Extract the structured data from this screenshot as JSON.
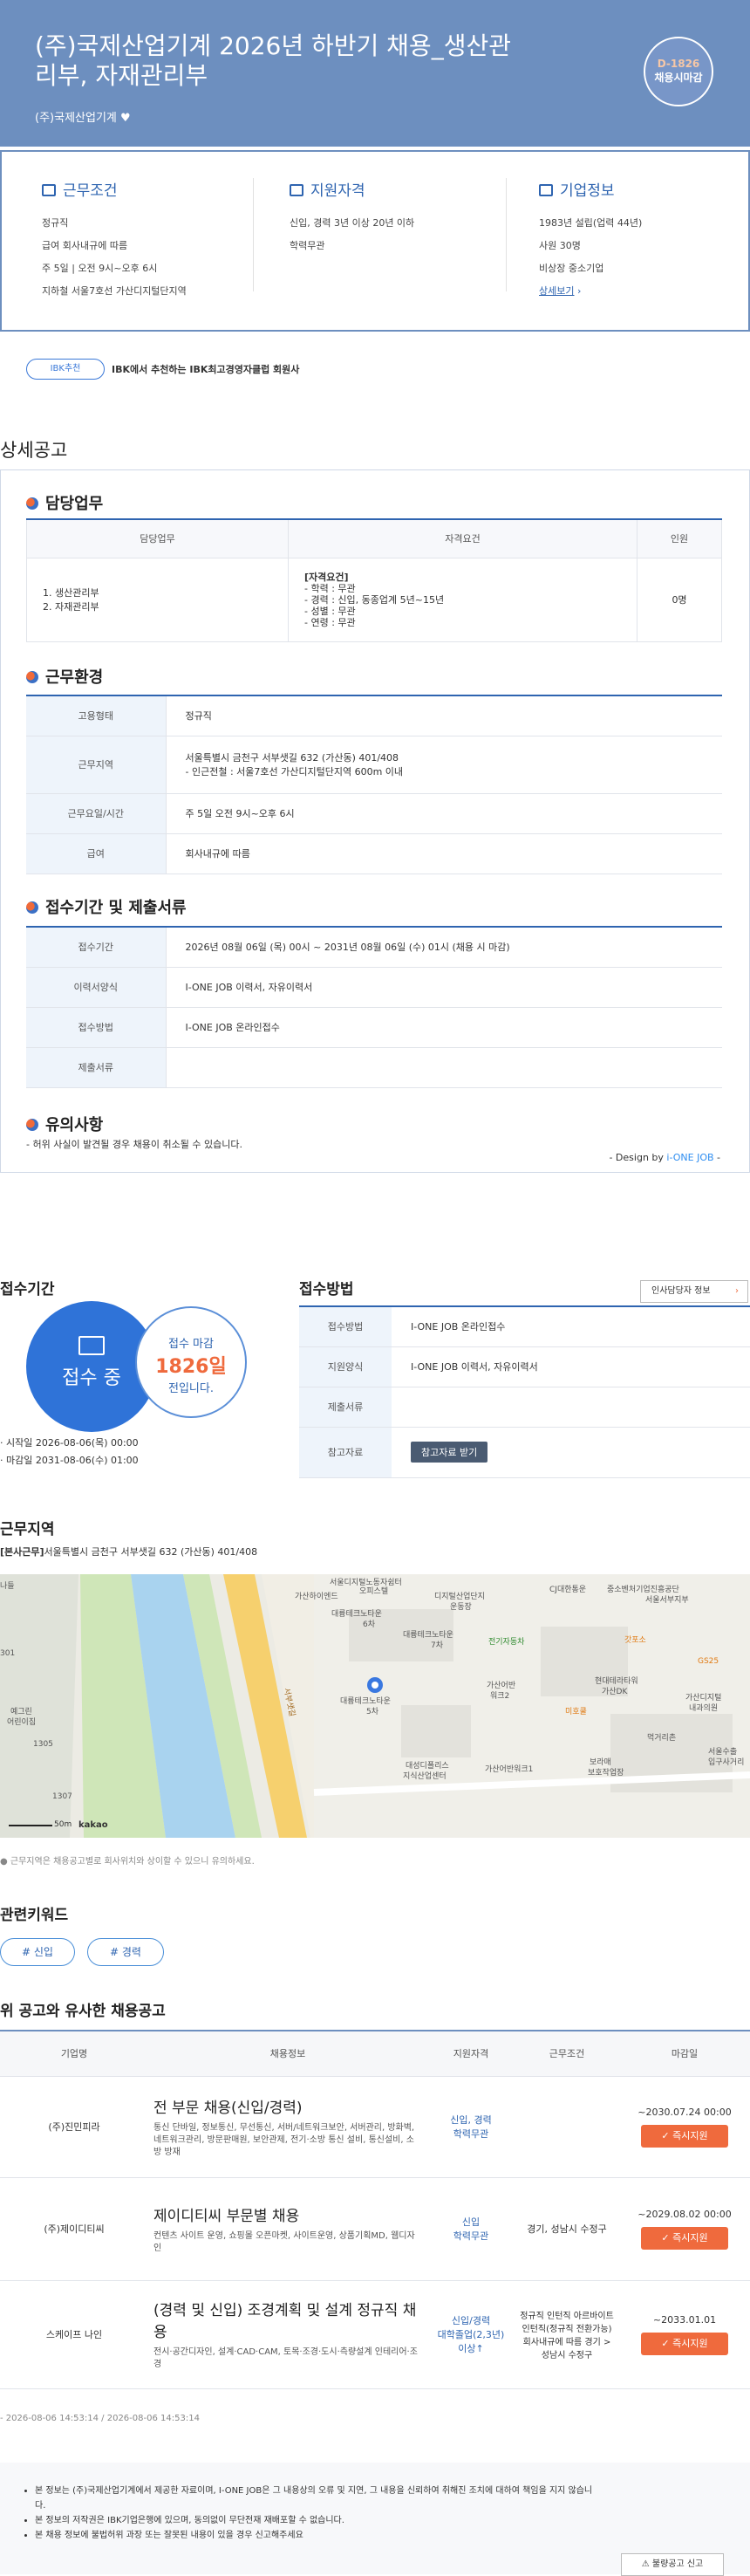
{
  "header": {
    "title": "(주)국제산업기계 2026년 하반기 채용_생산관리부, 자재관리부",
    "company": "(주)국제산업기계",
    "dday": "D-1826",
    "dday_label": "채용시마감"
  },
  "summary": {
    "work": {
      "title": "근무조건",
      "lines": [
        "정규직",
        "급여 회사내규에 따름",
        "주 5일 | 오전 9시~오후 6시",
        "지하철 서울7호선 가산디지털단지역"
      ]
    },
    "qual": {
      "title": "지원자격",
      "lines": [
        "신입, 경력 3년 이상 20년 이하",
        "학력무관"
      ]
    },
    "company": {
      "title": "기업정보",
      "lines": [
        "1983년 설립(업력 44년)",
        "사원 30명",
        "비상장 중소기업"
      ],
      "more": "상세보기"
    }
  },
  "ibk": {
    "badge": "IBK추천",
    "text": "IBK에서 추천하는 IBK최고경영자클럽 회원사"
  },
  "detail": {
    "title": "상세공고",
    "duty": {
      "title": "담당업무",
      "headers": [
        "담당업무",
        "자격요건",
        "인원"
      ],
      "tasks": [
        "1. 생산관리부",
        "2. 자재관리부"
      ],
      "req_title": "[자격요건]",
      "reqs": [
        "- 학력 : 무관",
        "- 경력 : 신입, 동종업계 5년~15년",
        "- 성별 : 무관",
        "- 연령 : 무관"
      ],
      "count": "0명"
    },
    "env": {
      "title": "근무환경",
      "rows": [
        {
          "k": "고용형태",
          "v": "정규직",
          "v2": ""
        },
        {
          "k": "근무지역",
          "v": "서울특별시 금천구 서부샛길 632 (가산동) 401/408",
          "v2": "- 인근전철 : 서울7호선 가산디지털단지역 600m 이내"
        },
        {
          "k": "근무요일/시간",
          "v": "주 5일 오전 9시~오후 6시",
          "v2": ""
        },
        {
          "k": "급여",
          "v": "회사내규에 따름",
          "v2": ""
        }
      ]
    },
    "period": {
      "title": "접수기간 및 제출서류",
      "rows": [
        {
          "k": "접수기간",
          "v": "2026년 08월 06일 (목) 00시 ~ 2031년 08월 06일 (수) 01시 (채용 시 마감)"
        },
        {
          "k": "이력서양식",
          "v": "I-ONE JOB 이력서, 자유이력서"
        },
        {
          "k": "접수방법",
          "v": "I-ONE JOB 온라인접수"
        },
        {
          "k": "제출서류",
          "v": ""
        }
      ]
    },
    "notice": {
      "title": "유의사항",
      "text": "- 허위 사실이 발견될 경우 채용이 취소될 수 있습니다."
    },
    "design": {
      "prefix": "- Design by ",
      "brand": "i-ONE JOB",
      "suffix": " -"
    }
  },
  "apply": {
    "title": "접수기간",
    "status": "접수 중",
    "deadline_label": "접수 마감",
    "days": "1826일",
    "remaining": "전입니다.",
    "start": "· 시작일 2026-08-06(목) 00:00",
    "end": "· 마감일 2031-08-06(수) 01:00",
    "method_title": "접수방법",
    "hr_button": "인사담당자 정보",
    "rows": [
      {
        "k": "접수방법",
        "v": "I-ONE JOB 온라인접수"
      },
      {
        "k": "지원양식",
        "v": "I-ONE JOB 이력서, 자유이력서"
      },
      {
        "k": "제출서류",
        "v": ""
      }
    ],
    "ref_label": "참고자료",
    "ref_button": "참고자료 받기"
  },
  "location": {
    "title": "근무지역",
    "tag": "[본사근무]",
    "address": "서울특별시 금천구 서부샛길 632 (가산동) 401/408",
    "caption": "● 근무지역은 채용공고별로 회사위치와 상이할 수 있으니 유의하세요.",
    "scale": "50m",
    "brand": "kakao",
    "labels": [
      "서울디지털노동자쉼터",
      "오피스텔",
      "가산하이엔드",
      "대륭테크노타운",
      "6차",
      "대륭테크노타운",
      "7차",
      "가산어반",
      "워크2",
      "대륭테크노타운",
      "5차",
      "대성디폴리스",
      "지식산업센터",
      "가산어반워크1",
      "디지털산업단지",
      "운동장",
      "CJ대한통운",
      "중소벤처기업진흥공단",
      "서울서부지부",
      "전기자동차",
      "갓포소",
      "GS25",
      "현대테라타워",
      "가산DK",
      "미호쿨",
      "가산디지털",
      "내과의원",
      "먹거리촌",
      "보라매",
      "보호작업장",
      "서울수출",
      "입구사거리",
      "예그린",
      "어린이집",
      "1305",
      "1307",
      "301",
      "나들",
      "서부샛길"
    ]
  },
  "keywords": {
    "title": "관련키워드",
    "items": [
      "# 신입",
      "# 경력"
    ]
  },
  "similar": {
    "title": "위 공고와 유사한 채용공고",
    "headers": [
      "기업명",
      "채용정보",
      "지원자격",
      "근무조건",
      "마감일"
    ],
    "rows": [
      {
        "company": "(주)진민피라",
        "title": "전 부문 채용(신입/경력)",
        "tags": "통신 단바일, 정보통신, 무선통신, 서버/네트워크보안, 서버관리, 방화벽, 네트워크관리, 방문판매원, 보안관제, 전기·소방 통신 설비, 통신설비, 소방 방재",
        "qual": "신입, 경력\n학력무관",
        "cond": "",
        "deadline": "~2030.07.24 00:00",
        "apply": "즉시지원"
      },
      {
        "company": "(주)제이디티씨",
        "title": "제이디티씨 부문별 채용",
        "tags": "컨텐츠 사이트 운영, 쇼핑몰 오픈마켓, 사이트운영, 상품기획MD, 웹디자인",
        "qual": "신입\n학력무관",
        "cond": "경기, 성남시 수정구",
        "deadline": "~2029.08.02 00:00",
        "apply": "즉시지원"
      },
      {
        "company": "스케이프 나인",
        "title": "(경력 및 신입) 조경계획 및 설계 정규직 채용",
        "tags": "전시·공간디자인, 설계·CAD·CAM, 토목·조경·도시·측량설계 인테리어·조경",
        "qual": "신입/경력\n대학졸업(2,3년)\n이상↑",
        "cond": "정규직 인턴직 아르바이트 인턴직(정규직 전환가능) 회사내규에 따름 경기 > 성남시 수정구",
        "deadline": "~2033.01.01",
        "apply": "즉시지원"
      }
    ]
  },
  "timestamp": "- 2026-08-06 14:53:14 / 2026-08-06 14:53:14",
  "footer": {
    "lines": [
      "본 정보는 (주)국제산업기계에서 제공한 자료이며, I-ONE JOB은 그 내용상의 오류 및 지연, 그 내용을 신뢰하여 취해진 조치에 대하여 책임을 지지 않습니다.",
      "본 정보의 저작권은 IBK기업은행에 있으며, 동의없이 무단전재 재배포할 수 없습니다.",
      "본 채용 정보에 불법허위 과장 또는 잘못된 내용이 있을 경우 신고해주세요"
    ],
    "report": "불량공고 신고"
  }
}
